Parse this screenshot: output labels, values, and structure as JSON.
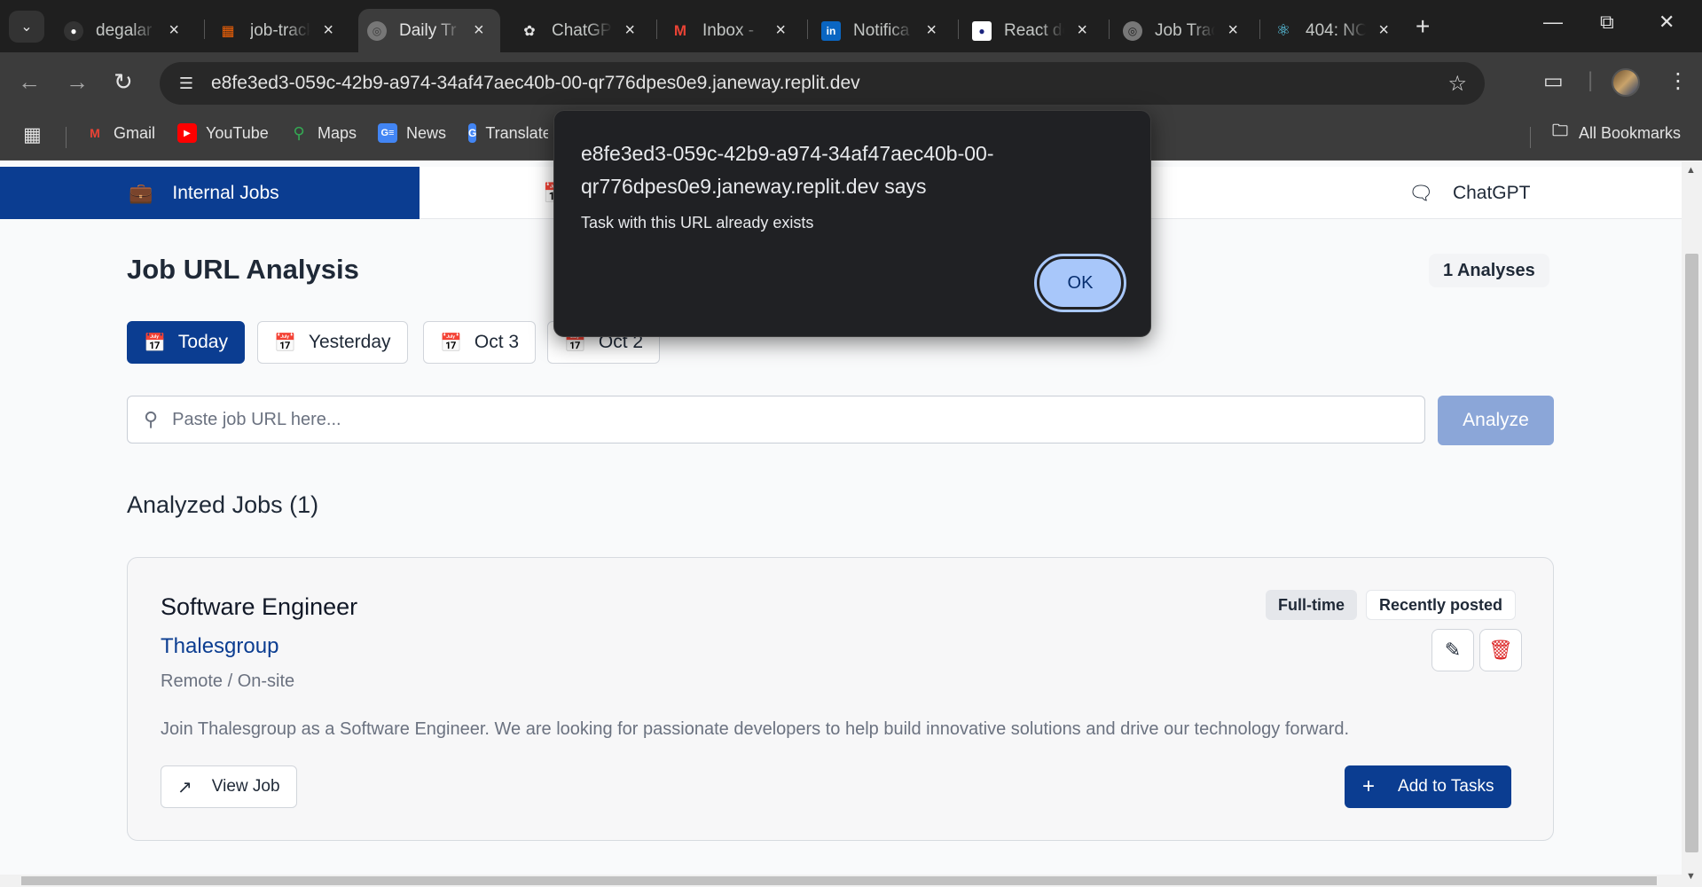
{
  "browser": {
    "tabs": [
      {
        "title": "degalar",
        "favicon": "github-icon"
      },
      {
        "title": "job-tracker",
        "favicon": "replit-icon"
      },
      {
        "title": "Daily Tr",
        "favicon": "globe-icon",
        "active": true
      },
      {
        "title": "ChatGPT",
        "favicon": "openai-icon"
      },
      {
        "title": "Inbox - ",
        "favicon": "gmail-icon"
      },
      {
        "title": "Notifica",
        "favicon": "linkedin-icon"
      },
      {
        "title": "React de",
        "favicon": "react-dot-icon"
      },
      {
        "title": "Job Trac",
        "favicon": "globe-icon"
      },
      {
        "title": "404: NO",
        "favicon": "react-icon"
      }
    ],
    "url": "e8fe3ed3-059c-42b9-a974-34af47aec40b-00-qr776dpes0e9.janeway.replit.dev",
    "bookmarks": [
      {
        "label": "Gmail",
        "icon": "gmail-icon"
      },
      {
        "label": "YouTube",
        "icon": "youtube-icon"
      },
      {
        "label": "Maps",
        "icon": "maps-icon"
      },
      {
        "label": "News",
        "icon": "news-icon"
      },
      {
        "label": "Translate",
        "icon": "translate-icon"
      }
    ],
    "all_bookmarks": "All Bookmarks"
  },
  "app": {
    "nav": {
      "internal_jobs": "Internal Jobs",
      "chatgpt": "ChatGPT"
    },
    "heading": "Job URL Analysis",
    "analyses_badge": "1 Analyses",
    "date_filters": [
      "Today",
      "Yesterday",
      "Oct 3",
      "Oct 2"
    ],
    "search": {
      "placeholder": "Paste job URL here...",
      "value": ""
    },
    "analyze_label": "Analyze",
    "analyzed_heading": "Analyzed Jobs (1)",
    "job": {
      "title": "Software Engineer",
      "company": "Thalesgroup",
      "location": "Remote / On-site",
      "tags": [
        "Full-time",
        "Recently posted"
      ],
      "description": "Join Thalesgroup as a Software Engineer. We are looking for passionate developers to help build innovative solutions and drive our technology forward.",
      "view_label": "View Job",
      "add_label": "Add to Tasks"
    }
  },
  "dialog": {
    "title": "e8fe3ed3-059c-42b9-a974-34af47aec40b-00-qr776dpes0e9.janeway.replit.dev says",
    "message": "Task with this URL already exists",
    "ok_label": "OK"
  },
  "colors": {
    "primary": "#0b3d91",
    "analyze_disabled": "#8ba6d8",
    "dialog_bg": "#202124",
    "ok_button": "#a8c7fa",
    "delete_red": "#dc2626"
  }
}
